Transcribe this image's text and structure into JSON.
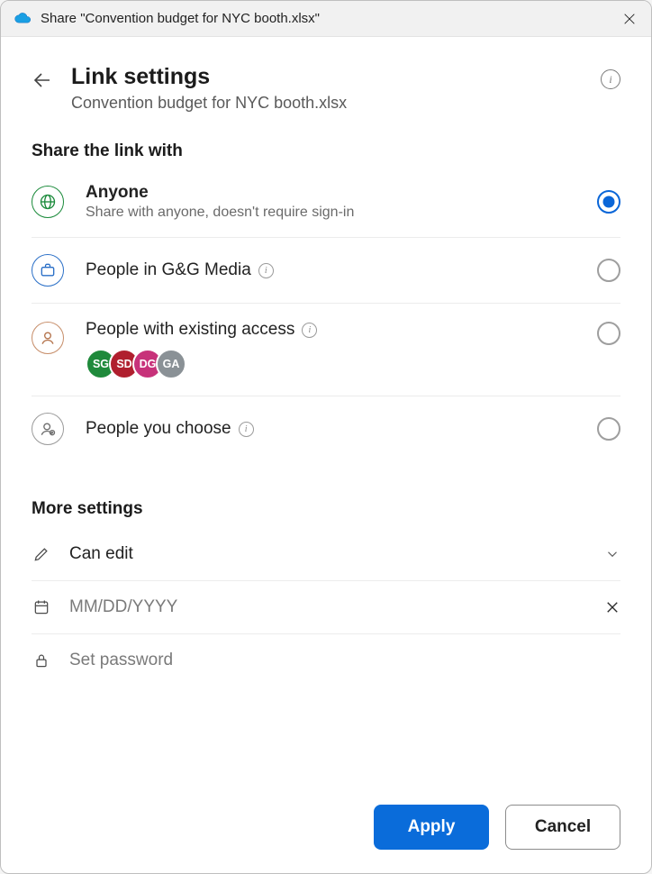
{
  "titlebar": {
    "text": "Share \"Convention budget for NYC booth.xlsx\""
  },
  "header": {
    "title": "Link settings",
    "subtitle": "Convention budget for NYC booth.xlsx"
  },
  "share": {
    "section_title": "Share the link with",
    "options": [
      {
        "title": "Anyone",
        "desc": "Share with anyone, doesn't require sign-in",
        "selected": true
      },
      {
        "title": "People in G&G Media",
        "selected": false
      },
      {
        "title": "People with existing access",
        "selected": false,
        "avatars": [
          {
            "initials": "SG",
            "color": "#1f8a3b"
          },
          {
            "initials": "SD",
            "color": "#b01f2e"
          },
          {
            "initials": "DG",
            "color": "#c7327a"
          },
          {
            "initials": "GA",
            "color": "#8a9196"
          }
        ]
      },
      {
        "title": "People you choose",
        "selected": false
      }
    ]
  },
  "more": {
    "section_title": "More settings",
    "permission": {
      "label": "Can edit"
    },
    "date": {
      "placeholder": "MM/DD/YYYY",
      "value": ""
    },
    "password": {
      "placeholder": "Set password",
      "value": ""
    }
  },
  "footer": {
    "apply": "Apply",
    "cancel": "Cancel"
  }
}
